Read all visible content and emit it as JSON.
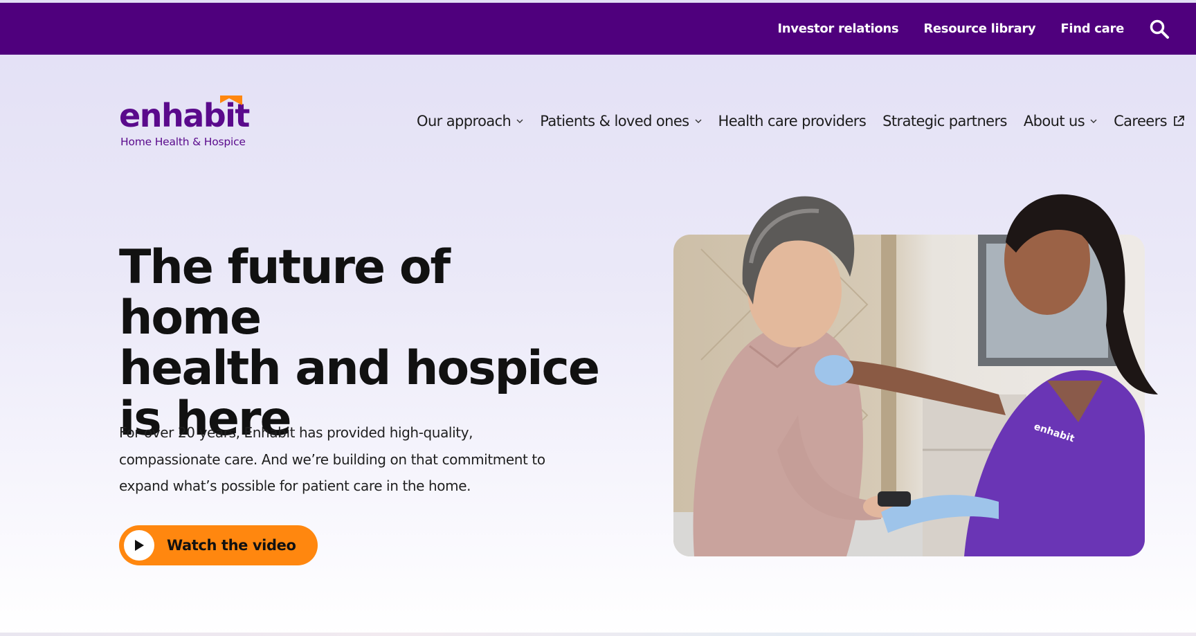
{
  "utility_nav": {
    "links": [
      "Investor relations",
      "Resource library",
      "Find care"
    ],
    "search_icon": "search-icon"
  },
  "logo": {
    "wordmark": "enhabit",
    "tagline": "Home Health & Hospice"
  },
  "main_nav": {
    "items": [
      {
        "label": "Our approach",
        "icon": "chevron-down-icon"
      },
      {
        "label": "Patients & loved ones",
        "icon": "chevron-down-icon"
      },
      {
        "label": "Health care providers"
      },
      {
        "label": "Strategic partners"
      },
      {
        "label": "About us",
        "icon": "chevron-down-icon"
      },
      {
        "label": "Careers",
        "icon": "external-link-icon"
      }
    ]
  },
  "hero": {
    "title_lines": [
      "The future of home",
      "health and hospice",
      "is here"
    ],
    "body_lines": [
      "For over 20 years, Enhabit has provided high-quality,",
      "compassionate care. And we’re building on that commitment to",
      "expand what’s possible for patient care in the home."
    ],
    "cta_label": "Watch the video",
    "cta_icon": "play-icon"
  },
  "colors": {
    "brand_purple": "#4f007d",
    "logo_purple": "#5a0a8c",
    "accent_orange": "#ff870f"
  }
}
